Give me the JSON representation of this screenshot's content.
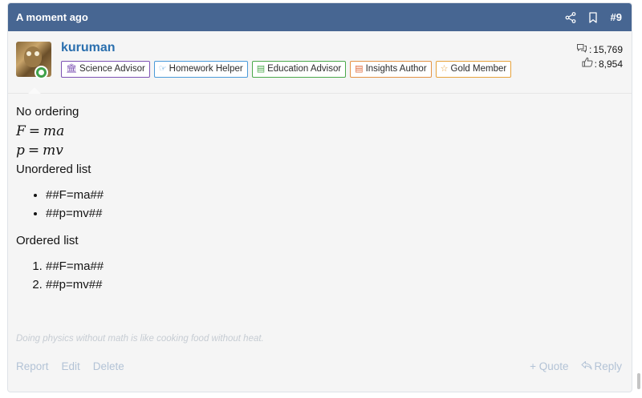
{
  "header": {
    "time": "A moment ago",
    "post_number": "#9",
    "icons": [
      "share-icon",
      "bookmark-icon"
    ]
  },
  "user": {
    "name": "kuruman",
    "online": true,
    "badges": [
      {
        "label": "Science Advisor",
        "icon": "institution-icon"
      },
      {
        "label": "Homework Helper",
        "icon": "hand-point-icon"
      },
      {
        "label": "Education Advisor",
        "icon": "book-icon"
      },
      {
        "label": "Insights Author",
        "icon": "document-icon"
      },
      {
        "label": "Gold Member",
        "icon": "star-icon"
      }
    ],
    "stats": {
      "messages": "15,769",
      "messages_sep": ":",
      "reactions": "8,954",
      "reactions_sep": ":"
    }
  },
  "content": {
    "heading_no_order": "No ordering",
    "eq1": {
      "lhs": "F",
      "op": "=",
      "rhs": "ma"
    },
    "eq2": {
      "lhs": "p",
      "op": "=",
      "rhs": "mv"
    },
    "heading_unordered": "Unordered list",
    "unordered_items": [
      "##F=ma##",
      "##p=mv##"
    ],
    "heading_ordered": "Ordered list",
    "ordered_items": [
      "##F=ma##",
      "##p=mv##"
    ]
  },
  "signature": "Doing physics without math is like cooking food without heat.",
  "actions": {
    "report": "Report",
    "edit": "Edit",
    "delete": "Delete",
    "quote": "+ Quote",
    "reply": "Reply"
  }
}
